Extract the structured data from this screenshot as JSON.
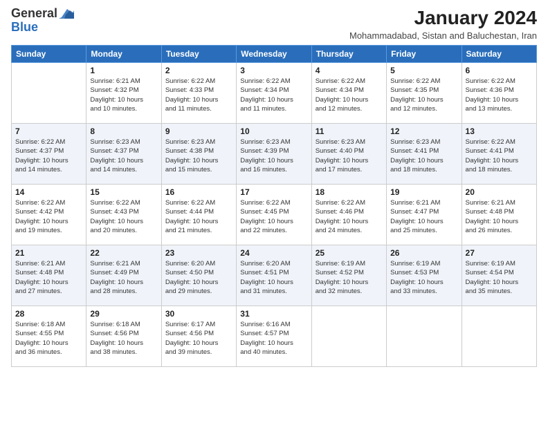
{
  "logo": {
    "line1": "General",
    "line2": "Blue"
  },
  "header": {
    "month_year": "January 2024",
    "location": "Mohammadabad, Sistan and Baluchestan, Iran"
  },
  "weekdays": [
    "Sunday",
    "Monday",
    "Tuesday",
    "Wednesday",
    "Thursday",
    "Friday",
    "Saturday"
  ],
  "weeks": [
    [
      {
        "day": "",
        "info": ""
      },
      {
        "day": "1",
        "info": "Sunrise: 6:21 AM\nSunset: 4:32 PM\nDaylight: 10 hours\nand 10 minutes."
      },
      {
        "day": "2",
        "info": "Sunrise: 6:22 AM\nSunset: 4:33 PM\nDaylight: 10 hours\nand 11 minutes."
      },
      {
        "day": "3",
        "info": "Sunrise: 6:22 AM\nSunset: 4:34 PM\nDaylight: 10 hours\nand 11 minutes."
      },
      {
        "day": "4",
        "info": "Sunrise: 6:22 AM\nSunset: 4:34 PM\nDaylight: 10 hours\nand 12 minutes."
      },
      {
        "day": "5",
        "info": "Sunrise: 6:22 AM\nSunset: 4:35 PM\nDaylight: 10 hours\nand 12 minutes."
      },
      {
        "day": "6",
        "info": "Sunrise: 6:22 AM\nSunset: 4:36 PM\nDaylight: 10 hours\nand 13 minutes."
      }
    ],
    [
      {
        "day": "7",
        "info": "Sunrise: 6:22 AM\nSunset: 4:37 PM\nDaylight: 10 hours\nand 14 minutes."
      },
      {
        "day": "8",
        "info": "Sunrise: 6:23 AM\nSunset: 4:37 PM\nDaylight: 10 hours\nand 14 minutes."
      },
      {
        "day": "9",
        "info": "Sunrise: 6:23 AM\nSunset: 4:38 PM\nDaylight: 10 hours\nand 15 minutes."
      },
      {
        "day": "10",
        "info": "Sunrise: 6:23 AM\nSunset: 4:39 PM\nDaylight: 10 hours\nand 16 minutes."
      },
      {
        "day": "11",
        "info": "Sunrise: 6:23 AM\nSunset: 4:40 PM\nDaylight: 10 hours\nand 17 minutes."
      },
      {
        "day": "12",
        "info": "Sunrise: 6:23 AM\nSunset: 4:41 PM\nDaylight: 10 hours\nand 18 minutes."
      },
      {
        "day": "13",
        "info": "Sunrise: 6:22 AM\nSunset: 4:41 PM\nDaylight: 10 hours\nand 18 minutes."
      }
    ],
    [
      {
        "day": "14",
        "info": "Sunrise: 6:22 AM\nSunset: 4:42 PM\nDaylight: 10 hours\nand 19 minutes."
      },
      {
        "day": "15",
        "info": "Sunrise: 6:22 AM\nSunset: 4:43 PM\nDaylight: 10 hours\nand 20 minutes."
      },
      {
        "day": "16",
        "info": "Sunrise: 6:22 AM\nSunset: 4:44 PM\nDaylight: 10 hours\nand 21 minutes."
      },
      {
        "day": "17",
        "info": "Sunrise: 6:22 AM\nSunset: 4:45 PM\nDaylight: 10 hours\nand 22 minutes."
      },
      {
        "day": "18",
        "info": "Sunrise: 6:22 AM\nSunset: 4:46 PM\nDaylight: 10 hours\nand 24 minutes."
      },
      {
        "day": "19",
        "info": "Sunrise: 6:21 AM\nSunset: 4:47 PM\nDaylight: 10 hours\nand 25 minutes."
      },
      {
        "day": "20",
        "info": "Sunrise: 6:21 AM\nSunset: 4:48 PM\nDaylight: 10 hours\nand 26 minutes."
      }
    ],
    [
      {
        "day": "21",
        "info": "Sunrise: 6:21 AM\nSunset: 4:48 PM\nDaylight: 10 hours\nand 27 minutes."
      },
      {
        "day": "22",
        "info": "Sunrise: 6:21 AM\nSunset: 4:49 PM\nDaylight: 10 hours\nand 28 minutes."
      },
      {
        "day": "23",
        "info": "Sunrise: 6:20 AM\nSunset: 4:50 PM\nDaylight: 10 hours\nand 29 minutes."
      },
      {
        "day": "24",
        "info": "Sunrise: 6:20 AM\nSunset: 4:51 PM\nDaylight: 10 hours\nand 31 minutes."
      },
      {
        "day": "25",
        "info": "Sunrise: 6:19 AM\nSunset: 4:52 PM\nDaylight: 10 hours\nand 32 minutes."
      },
      {
        "day": "26",
        "info": "Sunrise: 6:19 AM\nSunset: 4:53 PM\nDaylight: 10 hours\nand 33 minutes."
      },
      {
        "day": "27",
        "info": "Sunrise: 6:19 AM\nSunset: 4:54 PM\nDaylight: 10 hours\nand 35 minutes."
      }
    ],
    [
      {
        "day": "28",
        "info": "Sunrise: 6:18 AM\nSunset: 4:55 PM\nDaylight: 10 hours\nand 36 minutes."
      },
      {
        "day": "29",
        "info": "Sunrise: 6:18 AM\nSunset: 4:56 PM\nDaylight: 10 hours\nand 38 minutes."
      },
      {
        "day": "30",
        "info": "Sunrise: 6:17 AM\nSunset: 4:56 PM\nDaylight: 10 hours\nand 39 minutes."
      },
      {
        "day": "31",
        "info": "Sunrise: 6:16 AM\nSunset: 4:57 PM\nDaylight: 10 hours\nand 40 minutes."
      },
      {
        "day": "",
        "info": ""
      },
      {
        "day": "",
        "info": ""
      },
      {
        "day": "",
        "info": ""
      }
    ]
  ]
}
